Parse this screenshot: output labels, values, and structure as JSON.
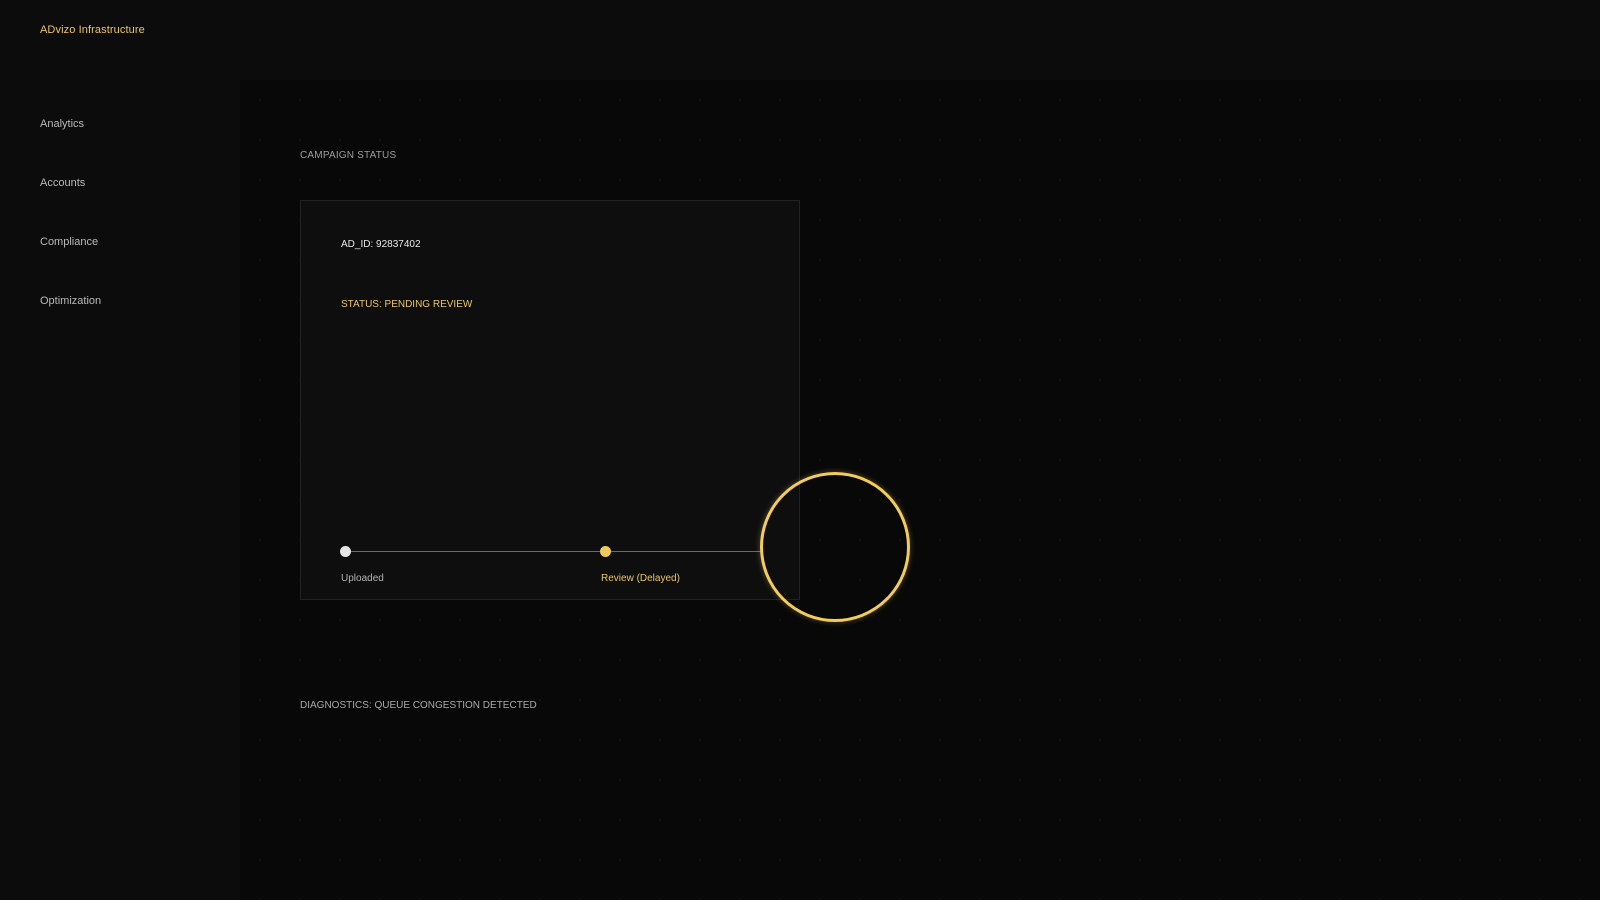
{
  "app": {
    "brand": "ADvizo Infrastructure"
  },
  "sidebar": {
    "items": [
      {
        "label": "Analytics"
      },
      {
        "label": "Accounts"
      },
      {
        "label": "Compliance"
      },
      {
        "label": "Optimization"
      }
    ]
  },
  "main": {
    "section_label": "CAMPAIGN STATUS",
    "card": {
      "ad_id": "AD_ID: 92837402",
      "status": "STATUS: PENDING REVIEW",
      "steps": [
        {
          "label": "Uploaded",
          "state": "complete"
        },
        {
          "label": "Review (Delayed)",
          "state": "active"
        }
      ]
    },
    "diagnostics": "DIAGNOSTICS: QUEUE CONGESTION DETECTED"
  },
  "colors": {
    "accent": "#e9c46a",
    "background": "#0c0c0c",
    "card": "#0e0e0e"
  }
}
